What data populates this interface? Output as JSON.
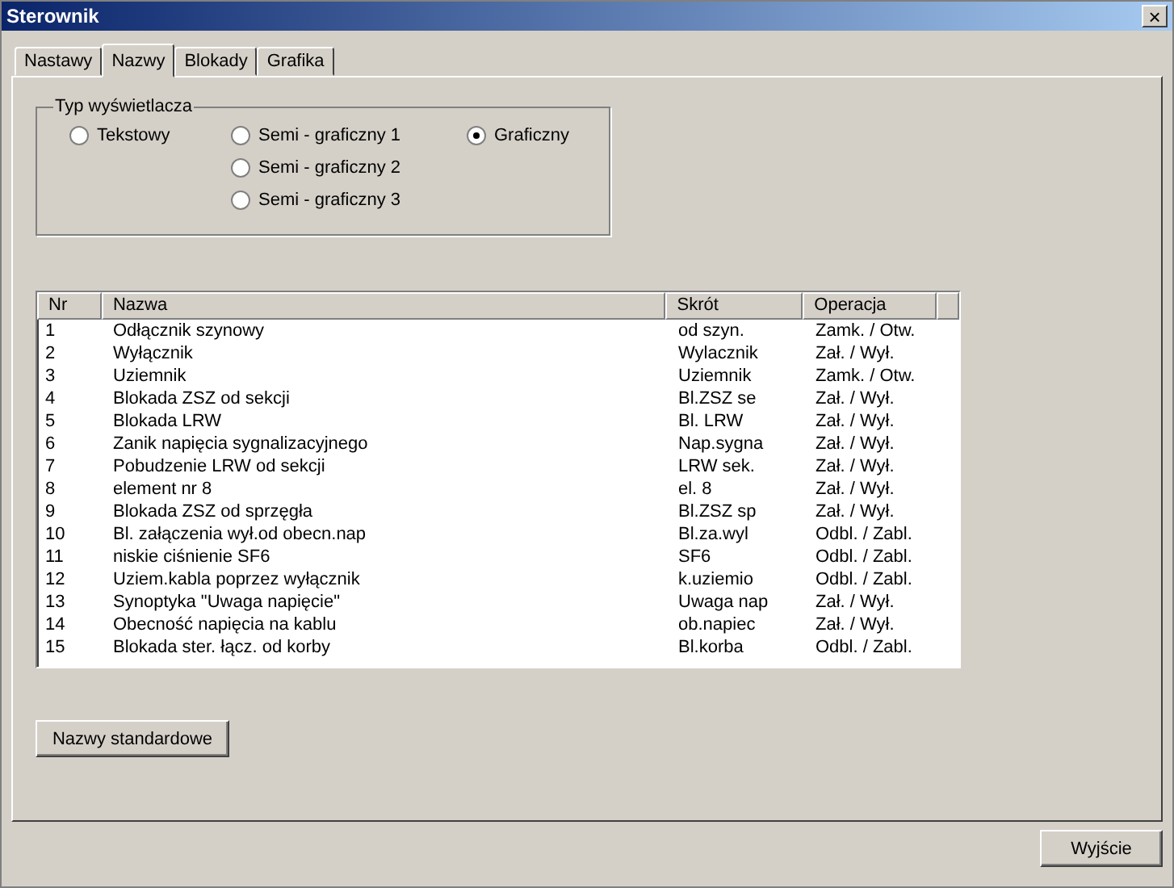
{
  "window": {
    "title": "Sterownik",
    "close": "×"
  },
  "tabs": [
    {
      "label": "Nastawy",
      "selected": false
    },
    {
      "label": "Nazwy",
      "selected": true
    },
    {
      "label": "Blokady",
      "selected": false
    },
    {
      "label": "Grafika",
      "selected": false
    }
  ],
  "display_type": {
    "title": "Typ wyświetlacza",
    "columns": [
      [
        {
          "label": "Tekstowy",
          "selected": false
        }
      ],
      [
        {
          "label": "Semi - graficzny  1",
          "selected": false
        },
        {
          "label": "Semi - graficzny  2",
          "selected": false
        },
        {
          "label": "Semi - graficzny  3",
          "selected": false
        }
      ],
      [
        {
          "label": "Graficzny",
          "selected": true
        }
      ]
    ]
  },
  "table": {
    "columns": [
      "Nr",
      "Nazwa",
      "Skrót",
      "Operacja"
    ],
    "rows": [
      [
        "1",
        "Odłącznik szynowy",
        "od szyn.",
        "Zamk. / Otw."
      ],
      [
        "2",
        "Wyłącznik",
        "Wylacznik",
        "Zał. / Wył."
      ],
      [
        "3",
        "Uziemnik",
        "Uziemnik",
        "Zamk. / Otw."
      ],
      [
        "4",
        "Blokada ZSZ od sekcji",
        "Bl.ZSZ se",
        "Zał. / Wył."
      ],
      [
        "5",
        "Blokada LRW",
        "Bl. LRW",
        "Zał. / Wył."
      ],
      [
        "6",
        "Zanik napięcia sygnalizacyjnego",
        "Nap.sygna",
        "Zał. / Wył."
      ],
      [
        "7",
        "Pobudzenie LRW od sekcji",
        "LRW sek.",
        "Zał. / Wył."
      ],
      [
        "8",
        "element nr 8",
        "el. 8",
        "Zał. / Wył."
      ],
      [
        "9",
        "Blokada ZSZ od sprzęgła",
        "Bl.ZSZ sp",
        "Zał. / Wył."
      ],
      [
        "10",
        "Bl. załączenia wył.od obecn.nap",
        "Bl.za.wyl",
        "Odbl. / Zabl."
      ],
      [
        "11",
        "niskie ciśnienie SF6",
        "SF6",
        "Odbl. / Zabl."
      ],
      [
        "12",
        "Uziem.kabla poprzez wyłącznik",
        "k.uziemio",
        "Odbl. / Zabl."
      ],
      [
        "13",
        "Synoptyka \"Uwaga napięcie\"",
        "Uwaga nap",
        "Zał. / Wył."
      ],
      [
        "14",
        "Obecność napięcia na kablu",
        "ob.napiec",
        "Zał. / Wył."
      ],
      [
        "15",
        "Blokada ster. łącz. od korby",
        "Bl.korba",
        "Odbl. / Zabl."
      ]
    ]
  },
  "buttons": {
    "standard_names": "Nazwy standardowe",
    "exit": "Wyjście"
  }
}
